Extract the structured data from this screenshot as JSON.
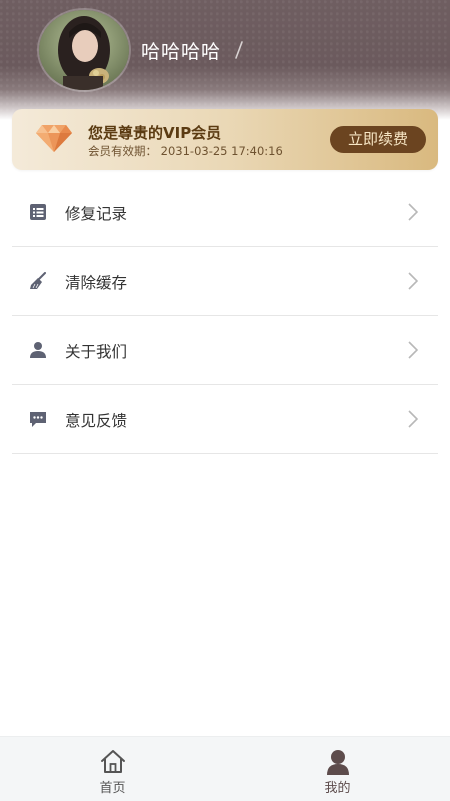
{
  "profile": {
    "username": "哈哈哈哈"
  },
  "vip": {
    "title": "您是尊贵的VIP会员",
    "expiry": "会员有效期：  2031-03-25 17:40:16",
    "renew_label": "立即续费",
    "accent_color": "#6b4420"
  },
  "menu": {
    "items": [
      {
        "label": "修复记录",
        "icon": "list-icon"
      },
      {
        "label": "清除缓存",
        "icon": "broom-icon"
      },
      {
        "label": "关于我们",
        "icon": "person-icon"
      },
      {
        "label": "意见反馈",
        "icon": "chat-bubble-icon"
      }
    ]
  },
  "nav": {
    "home_label": "首页",
    "mine_label": "我的",
    "active": "mine"
  }
}
